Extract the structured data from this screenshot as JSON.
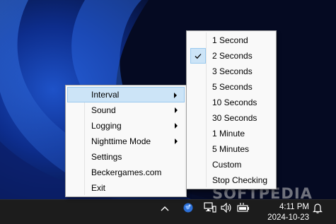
{
  "main_menu": {
    "items": [
      {
        "label": "Interval",
        "submenu": true,
        "highlighted": true
      },
      {
        "label": "Sound",
        "submenu": true
      },
      {
        "label": "Logging",
        "submenu": true
      },
      {
        "label": "Nighttime Mode",
        "submenu": true
      },
      {
        "label": "Settings"
      },
      {
        "label": "Beckergames.com"
      },
      {
        "label": "Exit"
      }
    ]
  },
  "interval_submenu": {
    "checked": "2 Seconds",
    "items": [
      {
        "label": "1 Second"
      },
      {
        "label": "2 Seconds"
      },
      {
        "label": "3 Seconds"
      },
      {
        "label": "5 Seconds"
      },
      {
        "label": "10 Seconds"
      },
      {
        "label": "30 Seconds"
      },
      {
        "label": "1 Minute"
      },
      {
        "label": "5 Minutes"
      },
      {
        "label": "Custom"
      },
      {
        "label": "Stop Checking"
      }
    ]
  },
  "taskbar": {
    "time": "4:11 PM",
    "date": "2024-10-23",
    "icons": [
      "chevron-up-icon",
      "globe-app-icon",
      "network-icon",
      "volume-icon",
      "battery-icon",
      "notification-bell-icon"
    ]
  },
  "watermark": "SOFTPEDIA",
  "colors": {
    "menu_bg": "#f9f9f9",
    "highlight_bg": "#cce4f7",
    "highlight_border": "#99c9ef",
    "taskbar_bg": "#1c1c1c"
  }
}
